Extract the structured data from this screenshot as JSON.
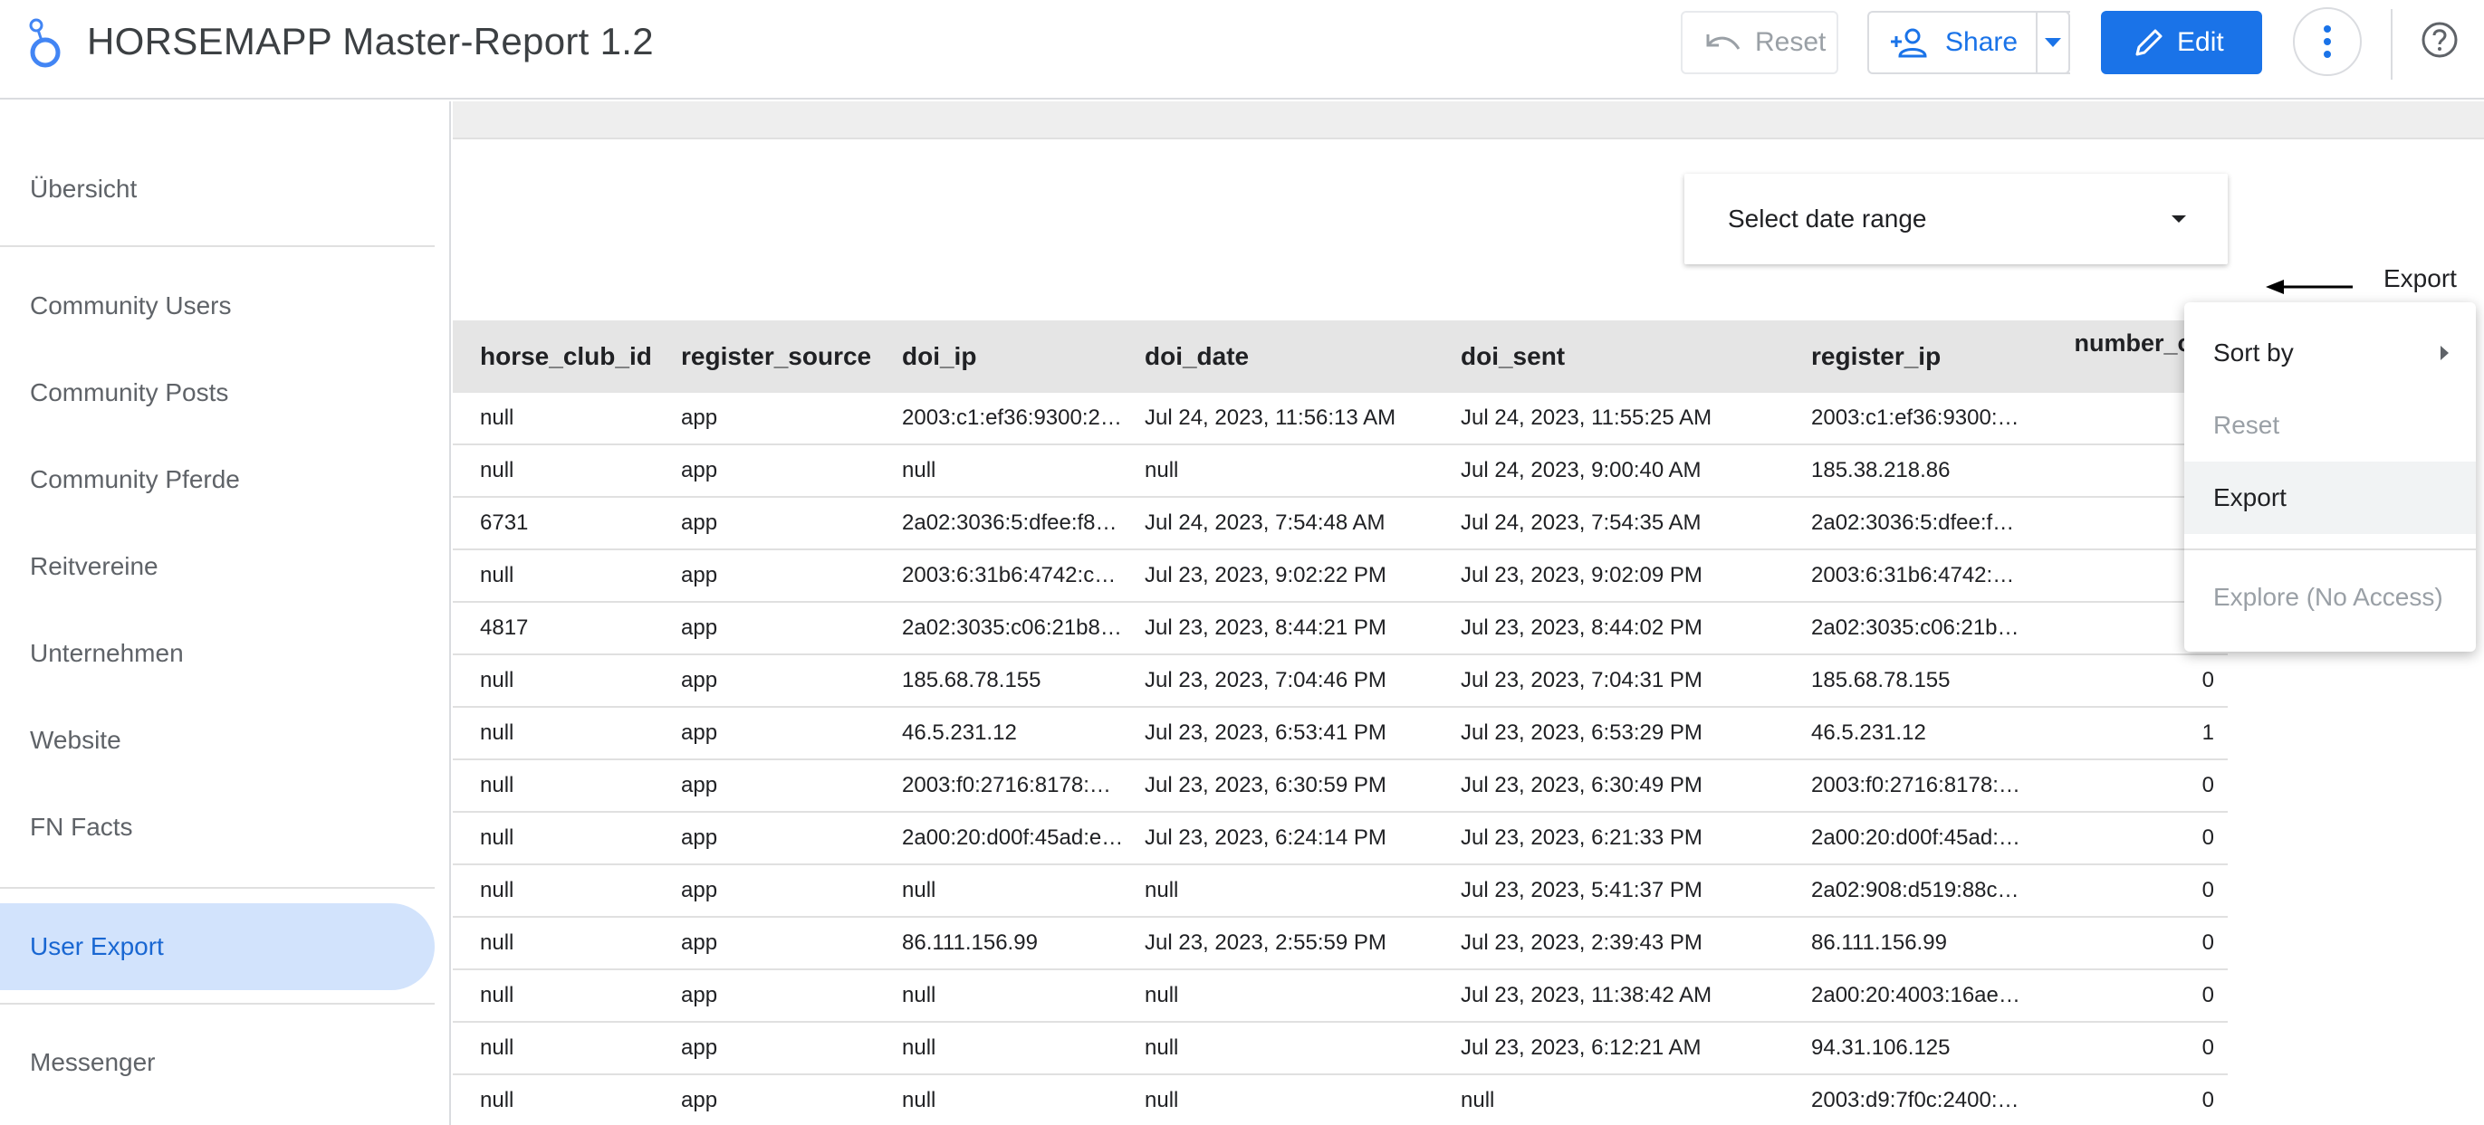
{
  "header": {
    "title": "HORSEMAPP Master-Report 1.2",
    "reset_label": "Reset",
    "share_label": "Share",
    "edit_label": "Edit"
  },
  "icons": {
    "logo": "looker-studio-logo",
    "reset": "undo-icon",
    "share": "person-add-icon",
    "edit": "pencil-icon",
    "more": "more-vert-icon",
    "help": "help-icon"
  },
  "colors": {
    "accent": "#1a73e8",
    "active_nav_bg": "#d2e3fc",
    "active_nav_text": "#1967d2"
  },
  "sidebar": {
    "items": [
      {
        "label": "Übersicht"
      },
      {
        "label": "Community Users"
      },
      {
        "label": "Community Posts"
      },
      {
        "label": "Community Pferde"
      },
      {
        "label": "Reitvereine"
      },
      {
        "label": "Unternehmen"
      },
      {
        "label": "Website"
      },
      {
        "label": "FN Facts"
      },
      {
        "label": "User Export"
      },
      {
        "label": "Messenger"
      }
    ],
    "active": "User Export"
  },
  "date_range": {
    "label": "Select date range"
  },
  "annotation": {
    "label": "Export"
  },
  "table": {
    "headers": [
      "horse_club_id",
      "register_source",
      "doi_ip",
      "doi_date",
      "doi_sent",
      "register_ip",
      "number_of_\nrs"
    ],
    "rows": [
      [
        "null",
        "app",
        "2003:c1:ef36:9300:2…",
        "Jul 24, 2023, 11:56:13 AM",
        "Jul 24, 2023, 11:55:25 AM",
        "2003:c1:ef36:9300:…",
        ""
      ],
      [
        "null",
        "app",
        "null",
        "null",
        "Jul 24, 2023, 9:00:40 AM",
        "185.38.218.86",
        ""
      ],
      [
        "6731",
        "app",
        "2a02:3036:5:dfee:f8…",
        "Jul 24, 2023, 7:54:48 AM",
        "Jul 24, 2023, 7:54:35 AM",
        "2a02:3036:5:dfee:f…",
        ""
      ],
      [
        "null",
        "app",
        "2003:6:31b6:4742:c…",
        "Jul 23, 2023, 9:02:22 PM",
        "Jul 23, 2023, 9:02:09 PM",
        "2003:6:31b6:4742:…",
        ""
      ],
      [
        "4817",
        "app",
        "2a02:3035:c06:21b8…",
        "Jul 23, 2023, 8:44:21 PM",
        "Jul 23, 2023, 8:44:02 PM",
        "2a02:3035:c06:21b…",
        ""
      ],
      [
        "null",
        "app",
        "185.68.78.155",
        "Jul 23, 2023, 7:04:46 PM",
        "Jul 23, 2023, 7:04:31 PM",
        "185.68.78.155",
        "0"
      ],
      [
        "null",
        "app",
        "46.5.231.12",
        "Jul 23, 2023, 6:53:41 PM",
        "Jul 23, 2023, 6:53:29 PM",
        "46.5.231.12",
        "1"
      ],
      [
        "null",
        "app",
        "2003:f0:2716:8178:…",
        "Jul 23, 2023, 6:30:59 PM",
        "Jul 23, 2023, 6:30:49 PM",
        "2003:f0:2716:8178:…",
        "0"
      ],
      [
        "null",
        "app",
        "2a00:20:d00f:45ad:e…",
        "Jul 23, 2023, 6:24:14 PM",
        "Jul 23, 2023, 6:21:33 PM",
        "2a00:20:d00f:45ad:…",
        "0"
      ],
      [
        "null",
        "app",
        "null",
        "null",
        "Jul 23, 2023, 5:41:37 PM",
        "2a02:908:d519:88c…",
        "0"
      ],
      [
        "null",
        "app",
        "86.111.156.99",
        "Jul 23, 2023, 2:55:59 PM",
        "Jul 23, 2023, 2:39:43 PM",
        "86.111.156.99",
        "0"
      ],
      [
        "null",
        "app",
        "null",
        "null",
        "Jul 23, 2023, 11:38:42 AM",
        "2a00:20:4003:16ae…",
        "0"
      ],
      [
        "null",
        "app",
        "null",
        "null",
        "Jul 23, 2023, 6:12:21 AM",
        "94.31.106.125",
        "0"
      ],
      [
        "null",
        "app",
        "null",
        "null",
        "null",
        "2003:d9:7f0c:2400:…",
        "0"
      ]
    ]
  },
  "context_menu": {
    "items": [
      {
        "label": "Sort by"
      },
      {
        "label": "Reset"
      },
      {
        "label": "Export"
      },
      {
        "label": "Explore (No Access)"
      }
    ]
  }
}
